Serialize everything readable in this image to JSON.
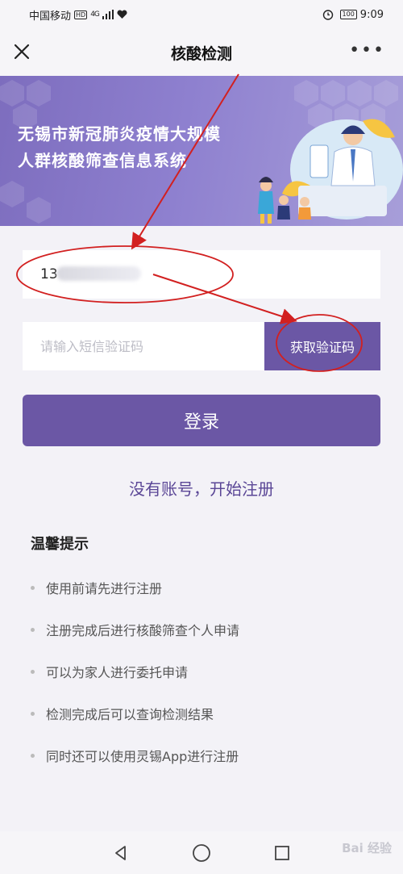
{
  "status_bar": {
    "carrier": "中国移动",
    "network": "HD",
    "signal": "4G",
    "battery": "100",
    "time": "9:09"
  },
  "nav": {
    "title": "核酸检测",
    "more": "•••"
  },
  "banner": {
    "line1": "无锡市新冠肺炎疫情大规模",
    "line2": "人群核酸筛查信息系统"
  },
  "form": {
    "phone_value": "13",
    "code_placeholder": "请输入短信验证码",
    "get_code_label": "获取验证码",
    "login_label": "登录",
    "register_label": "没有账号，开始注册"
  },
  "tips": {
    "title": "温馨提示",
    "items": [
      "使用前请先进行注册",
      "注册完成后进行核酸筛查个人申请",
      "可以为家人进行委托申请",
      "检测完成后可以查询检测结果",
      "同时还可以使用灵锡App进行注册"
    ]
  },
  "watermark": "Bai 经验",
  "colors": {
    "primary": "#6b57a5",
    "banner": "#8e80cf",
    "annotation": "#d22020"
  }
}
